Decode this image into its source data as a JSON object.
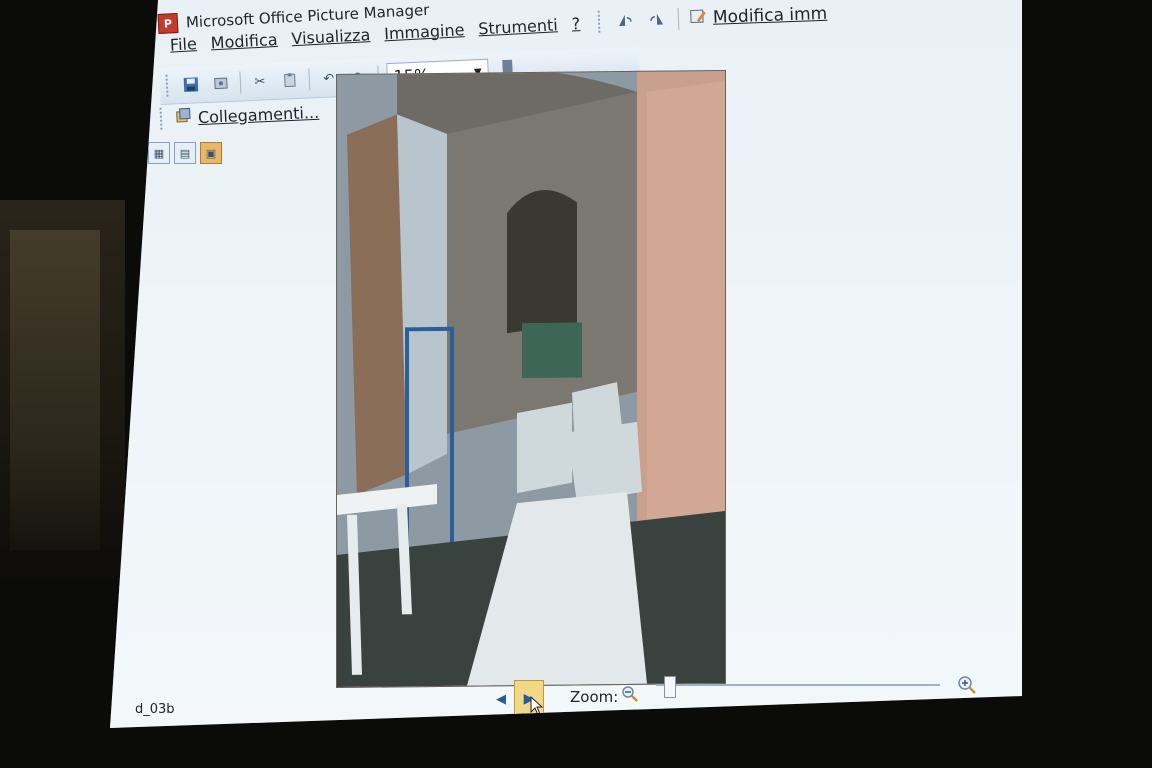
{
  "window": {
    "title": "Microsoft Office Picture Manager"
  },
  "menu": {
    "items": [
      {
        "label": "File"
      },
      {
        "label": "Modifica"
      },
      {
        "label": "Visualizza"
      },
      {
        "label": "Immagine"
      },
      {
        "label": "Strumenti"
      },
      {
        "label": "?"
      }
    ]
  },
  "toolbar": {
    "zoom_value": "15%",
    "links_label": "Collegamenti...",
    "edit_images_label": "Modifica imm"
  },
  "icons": {
    "app": "picture-manager-icon",
    "save": "save-icon",
    "properties": "properties-icon",
    "cut": "cut-icon",
    "paste": "paste-icon",
    "undo": "undo-icon",
    "redo": "redo-icon",
    "rotate_left": "rotate-left-icon",
    "rotate_right": "rotate-right-icon",
    "links": "shortcut-links-icon",
    "edit_images": "edit-pictures-icon",
    "view_thumbnails": "thumbnail-view-icon",
    "view_filmstrip": "filmstrip-view-icon",
    "view_single": "single-picture-view-icon",
    "prev": "previous-arrow-icon",
    "next": "next-arrow-icon",
    "zoom_out": "zoom-out-icon",
    "zoom_in": "zoom-in-icon"
  },
  "status": {
    "file_name": "d_03b",
    "zoom_label": "Zoom:",
    "zoom_level_fraction": 0.05
  },
  "colors": {
    "screen_bg": "#e9f1f6",
    "toolbar_bg": "#d6e3ef",
    "active_view": "#e7b86a",
    "nav_highlight": "#f2d98a"
  }
}
